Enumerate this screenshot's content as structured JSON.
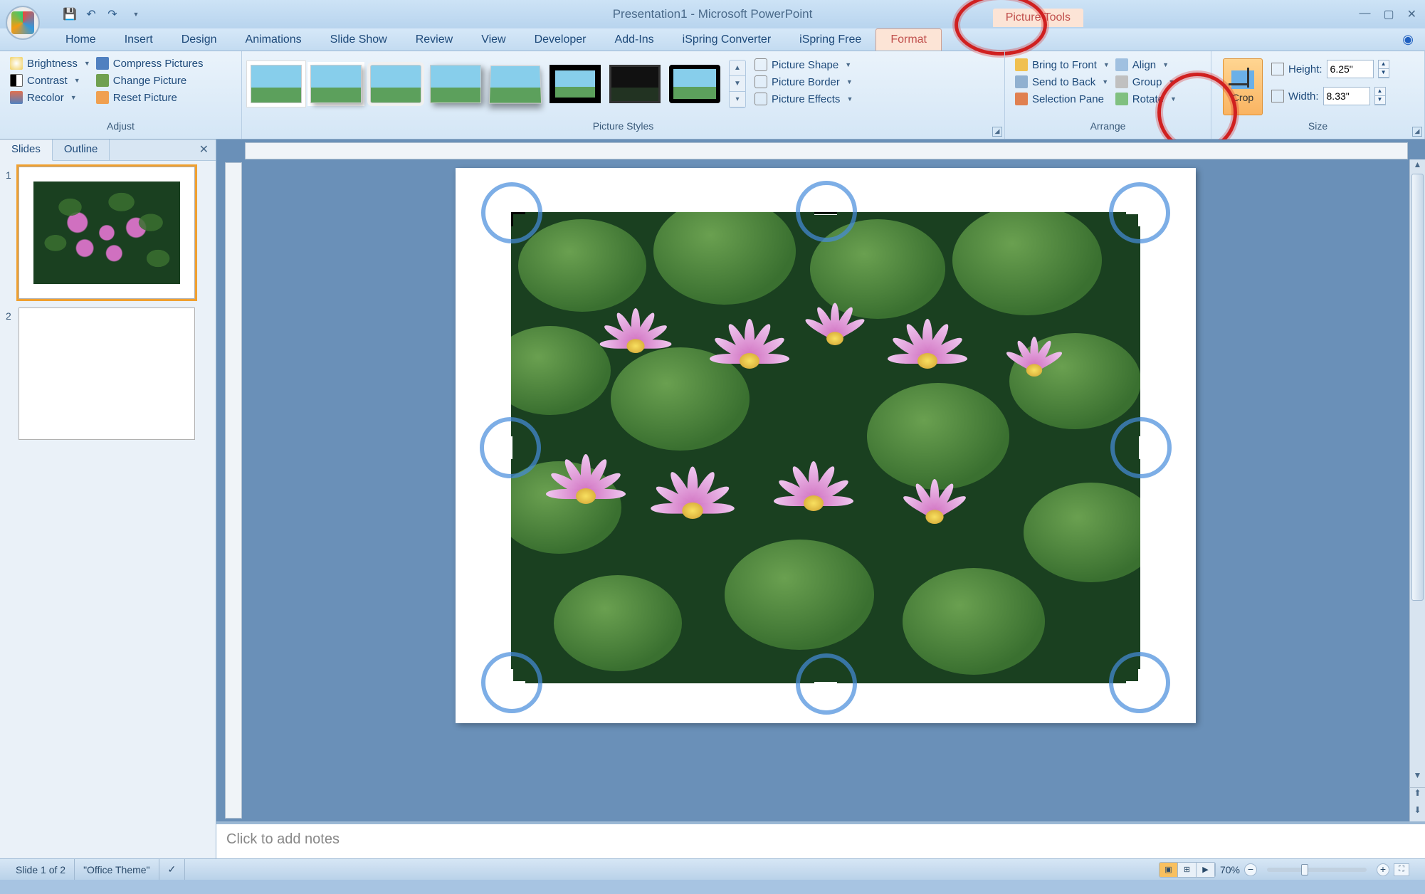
{
  "title": "Presentation1 - Microsoft PowerPoint",
  "context_tab": "Picture Tools",
  "tabs": {
    "home": "Home",
    "insert": "Insert",
    "design": "Design",
    "animations": "Animations",
    "slideshow": "Slide Show",
    "review": "Review",
    "view": "View",
    "developer": "Developer",
    "addins": "Add-Ins",
    "ispring_conv": "iSpring Converter",
    "ispring_free": "iSpring Free",
    "format": "Format"
  },
  "ribbon": {
    "adjust": {
      "label": "Adjust",
      "brightness": "Brightness",
      "contrast": "Contrast",
      "recolor": "Recolor",
      "compress": "Compress Pictures",
      "change": "Change Picture",
      "reset": "Reset Picture"
    },
    "picture_styles": {
      "label": "Picture Styles",
      "shape": "Picture Shape",
      "border": "Picture Border",
      "effects": "Picture Effects"
    },
    "arrange": {
      "label": "Arrange",
      "bring_front": "Bring to Front",
      "send_back": "Send to Back",
      "selection_pane": "Selection Pane",
      "align": "Align",
      "group": "Group",
      "rotate": "Rotate"
    },
    "size": {
      "label": "Size",
      "crop": "Crop",
      "height_label": "Height:",
      "height": "6.25\"",
      "width_label": "Width:",
      "width": "8.33\""
    }
  },
  "slide_panel": {
    "slides_tab": "Slides",
    "outline_tab": "Outline",
    "s1": "1",
    "s2": "2"
  },
  "notes_placeholder": "Click to add notes",
  "status": {
    "slide": "Slide 1 of 2",
    "theme": "\"Office Theme\"",
    "zoom": "70%"
  }
}
